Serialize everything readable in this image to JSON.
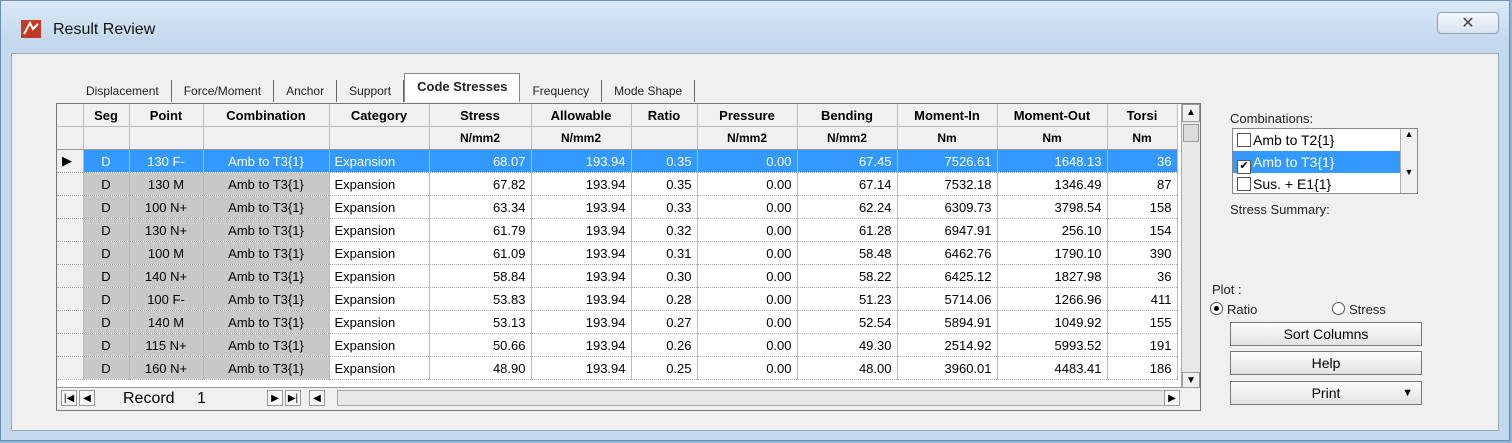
{
  "window": {
    "title": "Result Review",
    "close_label": "✕"
  },
  "tabs": [
    {
      "label": "Displacement"
    },
    {
      "label": "Force/Moment"
    },
    {
      "label": "Anchor"
    },
    {
      "label": "Support"
    },
    {
      "label": "Code Stresses",
      "active": true
    },
    {
      "label": "Frequency"
    },
    {
      "label": "Mode Shape"
    }
  ],
  "grid": {
    "headers": [
      "Seg",
      "Point",
      "Combination",
      "Category",
      "Stress",
      "Allowable",
      "Ratio",
      "Pressure",
      "Bending",
      "Moment-In",
      "Moment-Out",
      "Torsi"
    ],
    "units": [
      "",
      "",
      "",
      "",
      "N/mm2",
      "N/mm2",
      "",
      "N/mm2",
      "N/mm2",
      "Nm",
      "Nm",
      "Nm"
    ],
    "rows": [
      [
        "D",
        "130 F-",
        "Amb to T3{1}",
        "Expansion",
        "68.07",
        "193.94",
        "0.35",
        "0.00",
        "67.45",
        "7526.61",
        "1648.13",
        "36"
      ],
      [
        "D",
        "130 M",
        "Amb to T3{1}",
        "Expansion",
        "67.82",
        "193.94",
        "0.35",
        "0.00",
        "67.14",
        "7532.18",
        "1346.49",
        "87"
      ],
      [
        "D",
        "100 N+",
        "Amb to T3{1}",
        "Expansion",
        "63.34",
        "193.94",
        "0.33",
        "0.00",
        "62.24",
        "6309.73",
        "3798.54",
        "158"
      ],
      [
        "D",
        "130 N+",
        "Amb to T3{1}",
        "Expansion",
        "61.79",
        "193.94",
        "0.32",
        "0.00",
        "61.28",
        "6947.91",
        "256.10",
        "154"
      ],
      [
        "D",
        "100 M",
        "Amb to T3{1}",
        "Expansion",
        "61.09",
        "193.94",
        "0.31",
        "0.00",
        "58.48",
        "6462.76",
        "1790.10",
        "390"
      ],
      [
        "D",
        "140 N+",
        "Amb to T3{1}",
        "Expansion",
        "58.84",
        "193.94",
        "0.30",
        "0.00",
        "58.22",
        "6425.12",
        "1827.98",
        "36"
      ],
      [
        "D",
        "100 F-",
        "Amb to T3{1}",
        "Expansion",
        "53.83",
        "193.94",
        "0.28",
        "0.00",
        "51.23",
        "5714.06",
        "1266.96",
        "411"
      ],
      [
        "D",
        "140 M",
        "Amb to T3{1}",
        "Expansion",
        "53.13",
        "193.94",
        "0.27",
        "0.00",
        "52.54",
        "5894.91",
        "1049.92",
        "155"
      ],
      [
        "D",
        "115 N+",
        "Amb to T3{1}",
        "Expansion",
        "50.66",
        "193.94",
        "0.26",
        "0.00",
        "49.30",
        "2514.92",
        "5993.52",
        "191"
      ],
      [
        "D",
        "160 N+",
        "Amb to T3{1}",
        "Expansion",
        "48.90",
        "193.94",
        "0.25",
        "0.00",
        "48.00",
        "3960.01",
        "4483.41",
        "186"
      ]
    ],
    "selected_row": 0
  },
  "navigator": {
    "label": "Record",
    "value": "1"
  },
  "side": {
    "combinations_label": "Combinations:",
    "combinations": [
      {
        "label": "Amb to T2{1}",
        "checked": false,
        "selected": false
      },
      {
        "label": "Amb to T3{1}",
        "checked": true,
        "selected": true
      },
      {
        "label": "Sus. + E1{1}",
        "checked": false,
        "selected": false
      }
    ],
    "stress_summary_label": "Stress Summary:",
    "plot_label": "Plot :",
    "plot_options": [
      {
        "label": "Ratio",
        "selected": true
      },
      {
        "label": "Stress",
        "selected": false
      }
    ],
    "sort_columns_label": "Sort Columns",
    "help_label": "Help",
    "print_label": "Print"
  },
  "colors": {
    "selection": "#3399ff",
    "gray_cell": "#c8c8c8"
  }
}
